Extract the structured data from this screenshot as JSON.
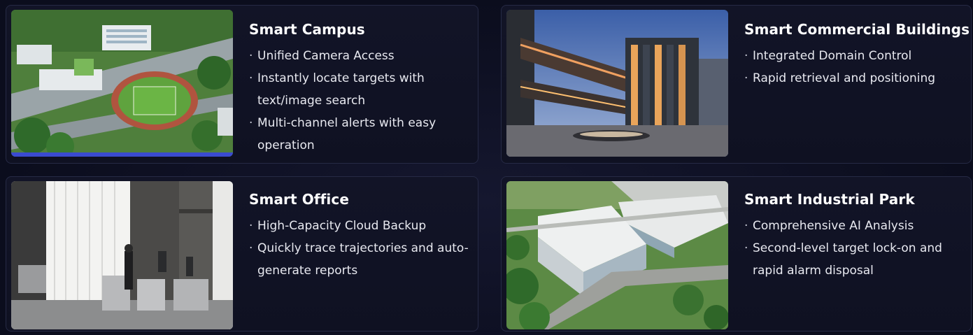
{
  "cards": [
    {
      "title": "Smart Campus",
      "image_icon": "campus-aerial-image",
      "features": [
        "Unified Camera Access",
        "Instantly locate targets with text/image search",
        "Multi-channel alerts with easy operation"
      ]
    },
    {
      "title": "Smart Commercial Buildings",
      "image_icon": "commercial-building-image",
      "features": [
        "Integrated Domain Control",
        "Rapid retrieval and positioning"
      ]
    },
    {
      "title": "Smart Office",
      "image_icon": "office-turnstile-image",
      "features": [
        "High-Capacity Cloud Backup",
        "Quickly trace trajectories and auto-generate reports"
      ]
    },
    {
      "title": "Smart Industrial Park",
      "image_icon": "industrial-park-image",
      "features": [
        "Comprehensive AI Analysis",
        "Second-level target lock-on and rapid alarm disposal"
      ]
    }
  ],
  "colors": {
    "background": "#0b0d1d",
    "card": "#121427",
    "card_border": "#262a45",
    "title": "#ffffff",
    "text": "#e8e9f0"
  }
}
